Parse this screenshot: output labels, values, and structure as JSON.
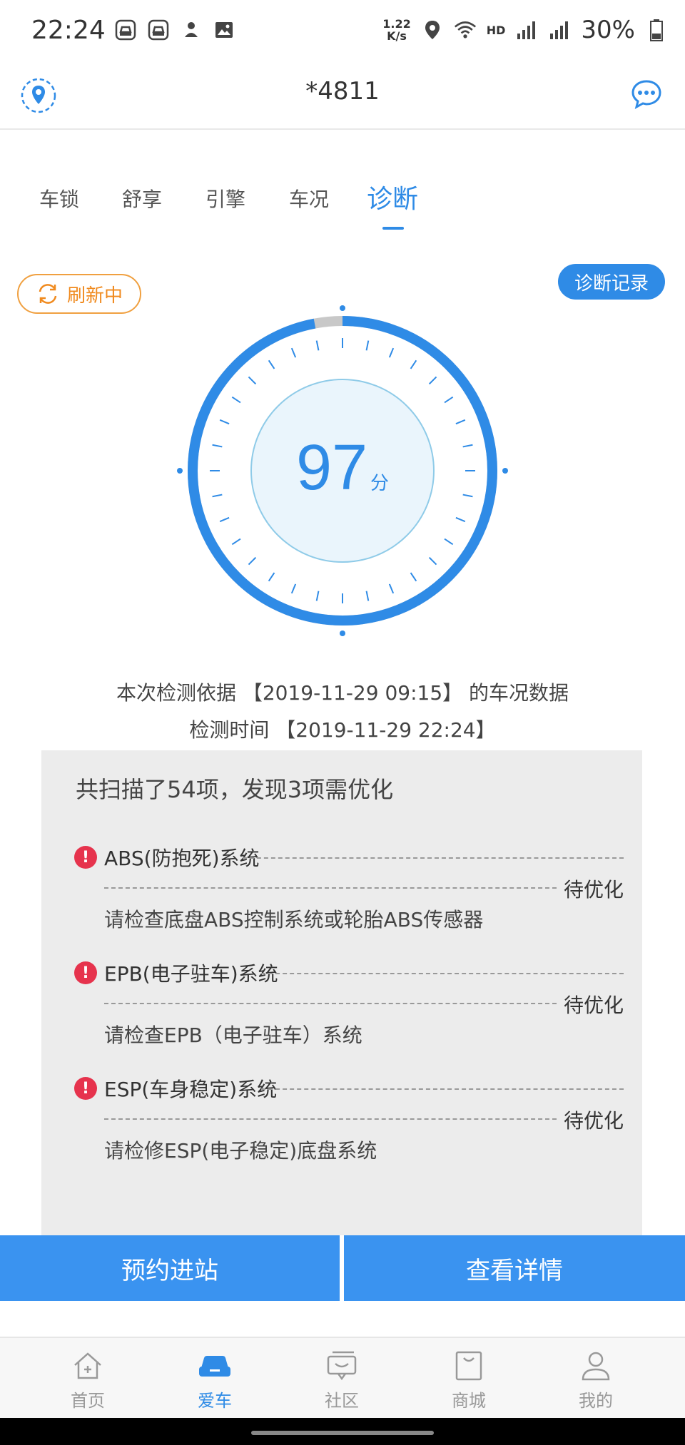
{
  "status_bar": {
    "time": "22:24",
    "speed": "1.22\nK/s",
    "network": "HD",
    "battery": "30%"
  },
  "header": {
    "title": "*4811"
  },
  "tabs": [
    {
      "label": "车锁",
      "active": false
    },
    {
      "label": "舒享",
      "active": false
    },
    {
      "label": "引擎",
      "active": false
    },
    {
      "label": "车况",
      "active": false
    },
    {
      "label": "诊断",
      "active": true
    }
  ],
  "refresh_label": "刷新中",
  "record_label": "诊断记录",
  "score": {
    "value": 97,
    "unit": "分",
    "max": 100
  },
  "basis_text": "本次检测依据 【2019-11-29 09:15】 的车况数据",
  "time_text": "检测时间 【2019-11-29 22:24】",
  "summary": "共扫描了54项，发现3项需优化",
  "issues": [
    {
      "name": "ABS(防抱死)系统",
      "status": "待优化",
      "detail": "请检查底盘ABS控制系统或轮胎ABS传感器"
    },
    {
      "name": "EPB(电子驻车)系统",
      "status": "待优化",
      "detail": "请检查EPB（电子驻车）系统"
    },
    {
      "name": "ESP(车身稳定)系统",
      "status": "待优化",
      "detail": "请检修ESP(电子稳定)底盘系统"
    }
  ],
  "actions": {
    "appointment": "预约进站",
    "details": "查看详情"
  },
  "bottom_nav": [
    {
      "label": "首页",
      "icon": "home-icon",
      "active": false
    },
    {
      "label": "爱车",
      "icon": "car-icon",
      "active": true
    },
    {
      "label": "社区",
      "icon": "community-icon",
      "active": false
    },
    {
      "label": "商城",
      "icon": "shop-icon",
      "active": false
    },
    {
      "label": "我的",
      "icon": "profile-icon",
      "active": false
    }
  ],
  "colors": {
    "accent": "#2f8be6",
    "warning": "#e6334d",
    "refresh": "#f08a1e"
  }
}
